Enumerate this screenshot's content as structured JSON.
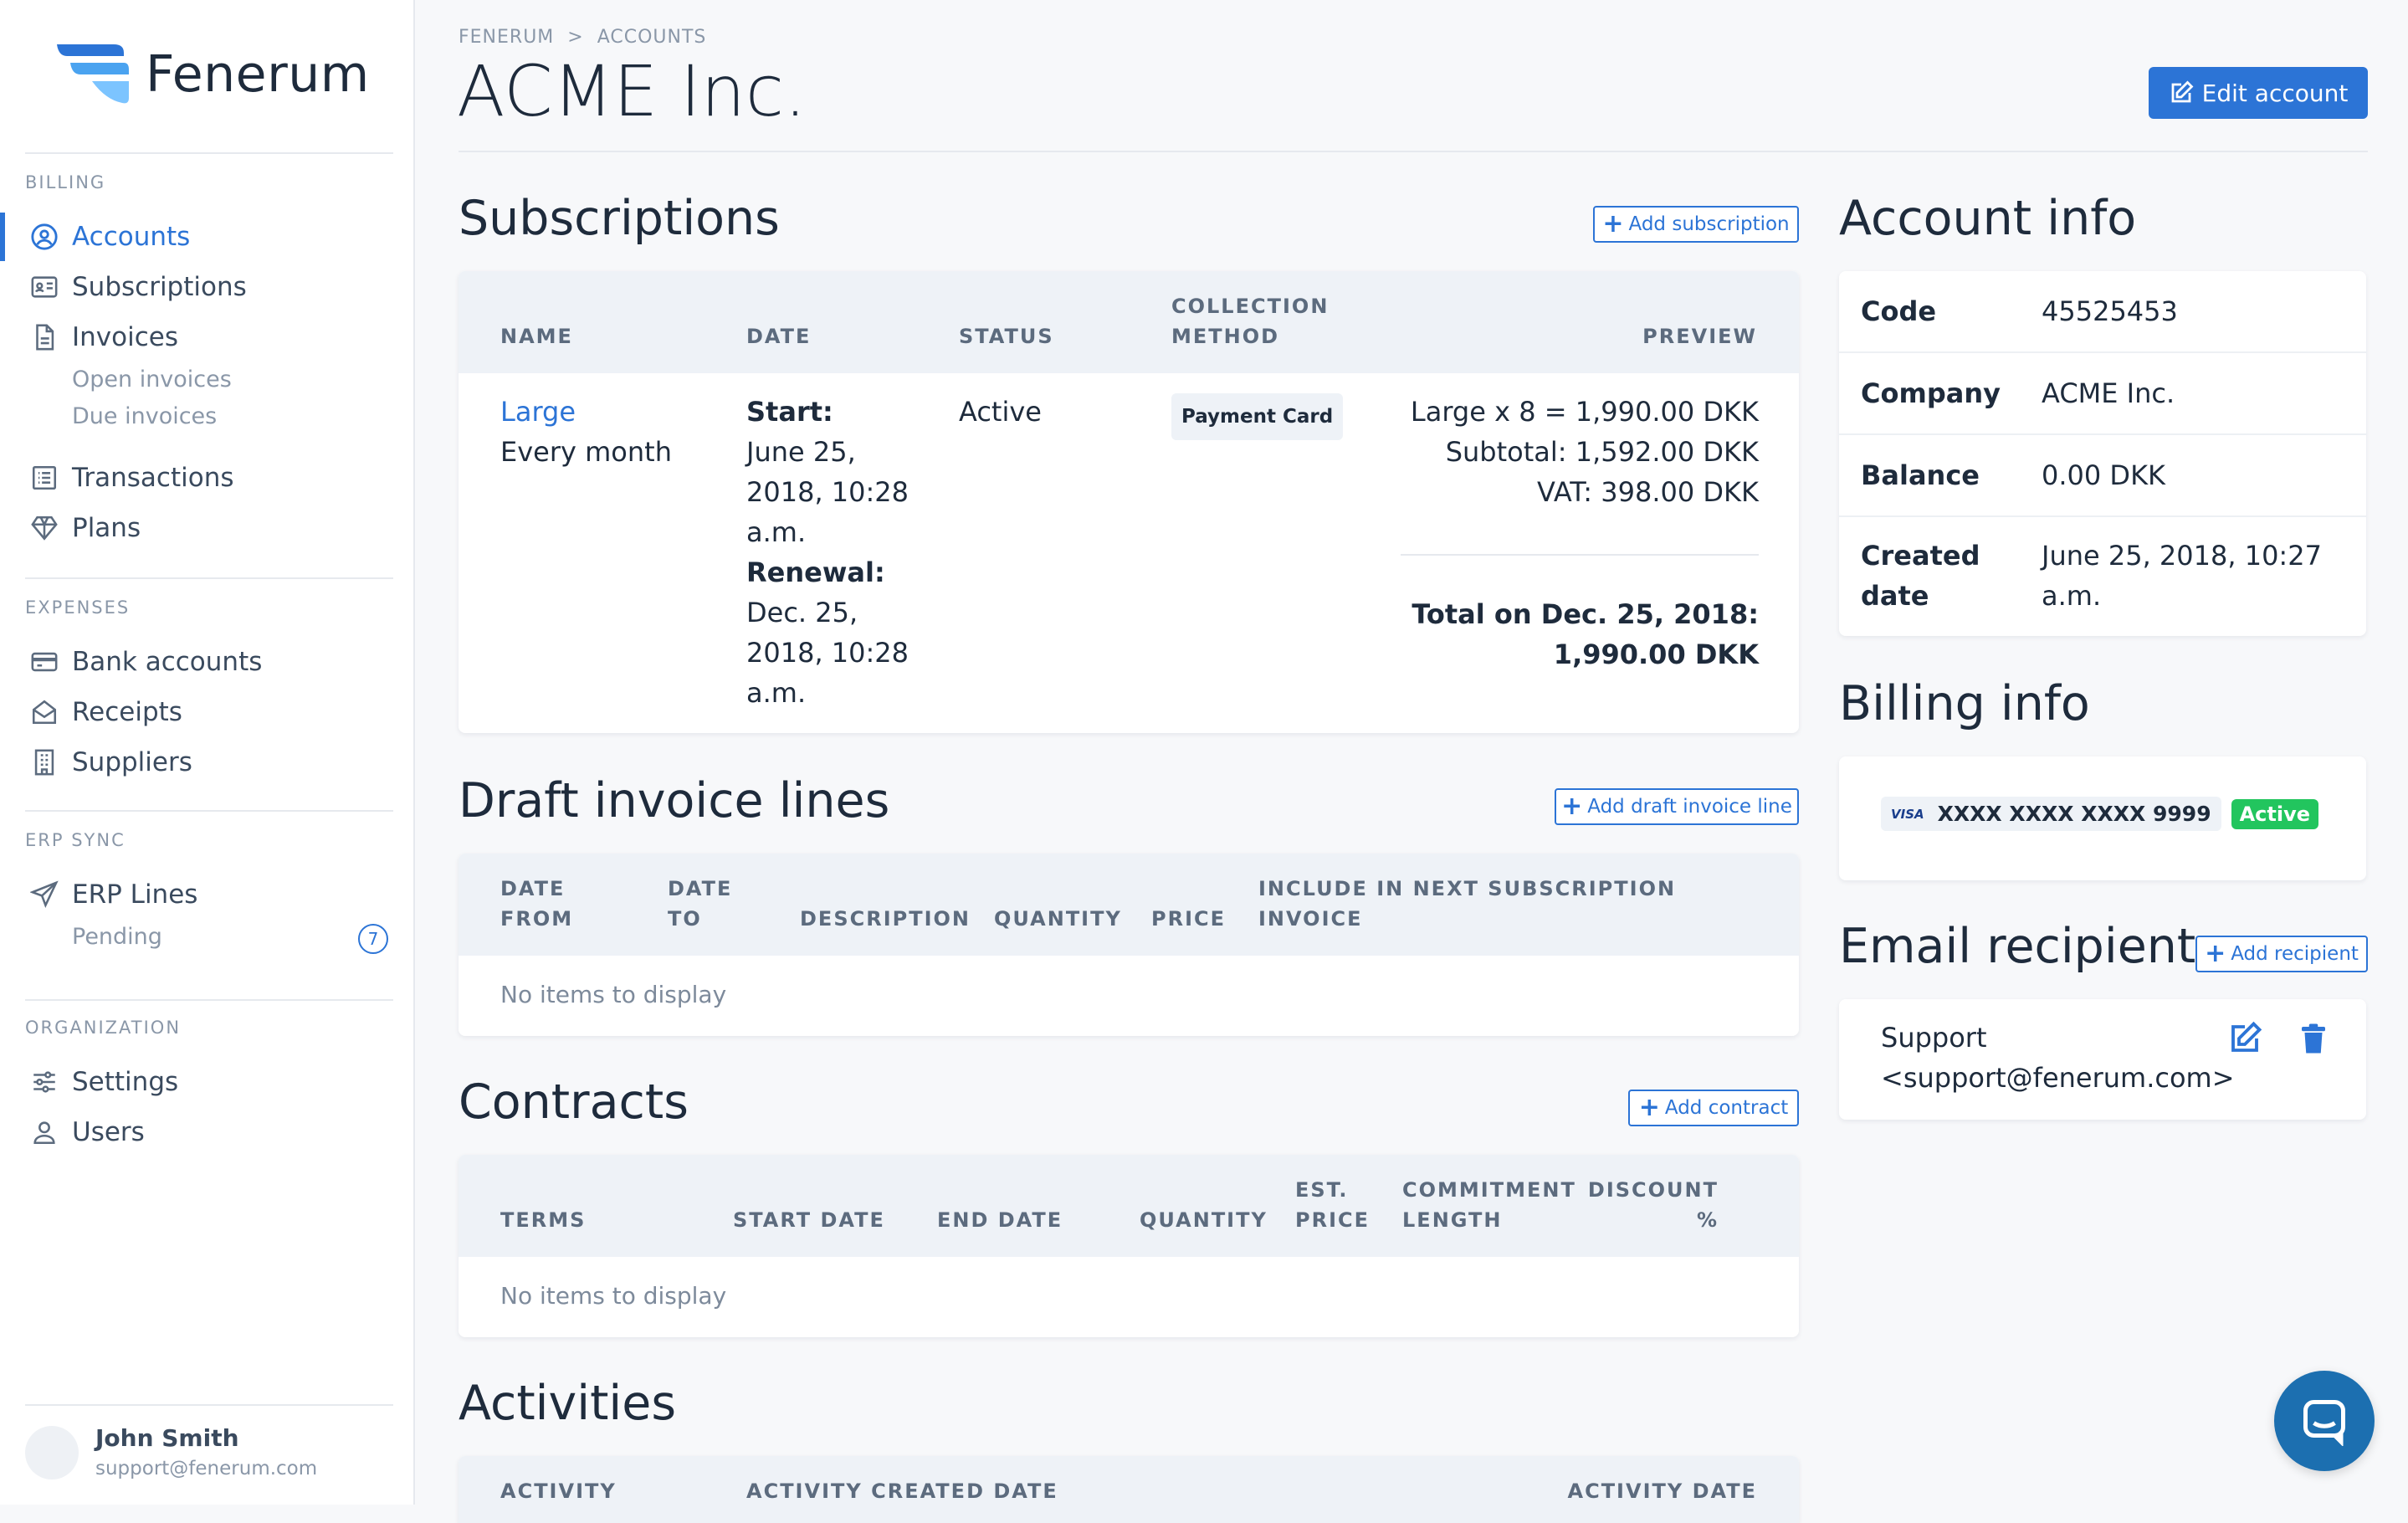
{
  "brand": {
    "name": "Fenerum",
    "accent": "#2c74d6"
  },
  "sidebar": {
    "sections": {
      "billing": "BILLING",
      "expenses": "EXPENSES",
      "erp": "ERP SYNC",
      "org": "ORGANIZATION"
    },
    "items": {
      "accounts": {
        "label": "Accounts",
        "icon": "user-circle-icon"
      },
      "subscriptions": {
        "label": "Subscriptions",
        "icon": "id-card-icon"
      },
      "invoices": {
        "label": "Invoices",
        "icon": "file-icon"
      },
      "open_invoices": "Open invoices",
      "due_invoices": "Due invoices",
      "transactions": {
        "label": "Transactions",
        "icon": "list-icon"
      },
      "plans": {
        "label": "Plans",
        "icon": "gem-icon"
      },
      "bank_accounts": {
        "label": "Bank accounts",
        "icon": "credit-card-icon"
      },
      "receipts": {
        "label": "Receipts",
        "icon": "envelope-open-icon"
      },
      "suppliers": {
        "label": "Suppliers",
        "icon": "building-icon"
      },
      "erp_lines": {
        "label": "ERP Lines",
        "icon": "paper-plane-icon"
      },
      "pending": {
        "label": "Pending",
        "count": "7"
      },
      "settings": {
        "label": "Settings",
        "icon": "sliders-icon"
      },
      "users": {
        "label": "Users",
        "icon": "user-icon"
      }
    },
    "user": {
      "name": "John Smith",
      "email": "support@fenerum.com"
    }
  },
  "header": {
    "breadcrumb": [
      "FENERUM",
      ">",
      "ACCOUNTS"
    ],
    "title": "ACME Inc.",
    "edit_button": "Edit account"
  },
  "subscriptions": {
    "title": "Subscriptions",
    "add_button": "Add subscription",
    "columns": {
      "name": "NAME",
      "date": "DATE",
      "status": "STATUS",
      "method_1": "COLLECTION",
      "method_2": "METHOD",
      "preview": "PREVIEW"
    },
    "rows": [
      {
        "name": "Large",
        "interval": "Every month",
        "start_label": "Start:",
        "start_1": "June 25,",
        "start_2": "2018, 10:28",
        "start_3": "a.m.",
        "renewal_label": "Renewal:",
        "renewal_1": "Dec. 25,",
        "renewal_2": "2018, 10:28",
        "renewal_3": "a.m.",
        "status": "Active",
        "method": "Payment Card",
        "preview_line": "Large x 8 = 1,990.00 DKK",
        "subtotal": "Subtotal: 1,592.00 DKK",
        "vat": "VAT: 398.00 DKK",
        "total_label": "Total on Dec. 25, 2018:",
        "total_value": "1,990.00 DKK"
      }
    ]
  },
  "draft_lines": {
    "title": "Draft invoice lines",
    "add_button": "Add draft invoice line",
    "columns": {
      "date_from_1": "DATE",
      "date_from_2": "FROM",
      "date_to_1": "DATE",
      "date_to_2": "TO",
      "description": "DESCRIPTION",
      "quantity": "QUANTITY",
      "price": "PRICE",
      "include_1": "INCLUDE IN NEXT SUBSCRIPTION",
      "include_2": "INVOICE"
    },
    "empty": "No items to display"
  },
  "contracts": {
    "title": "Contracts",
    "add_button": "Add contract",
    "columns": {
      "terms": "TERMS",
      "start": "START DATE",
      "end": "END DATE",
      "quantity": "QUANTITY",
      "est_1": "EST.",
      "est_2": "PRICE",
      "commit_1": "COMMITMENT",
      "commit_2": "LENGTH",
      "discount_1": "DISCOUNT",
      "discount_2": "%"
    },
    "empty": "No items to display"
  },
  "activities": {
    "title": "Activities",
    "columns": {
      "activity": "ACTIVITY",
      "created": "ACTIVITY CREATED DATE",
      "date": "ACTIVITY DATE"
    }
  },
  "account_info": {
    "title": "Account info",
    "rows": [
      {
        "key": "Code",
        "value": "45525453"
      },
      {
        "key": "Company",
        "value": "ACME Inc."
      },
      {
        "key": "Balance",
        "value": "0.00 DKK"
      },
      {
        "key_1": "Created",
        "key_2": "date",
        "value_1": "June 25, 2018, 10:27",
        "value_2": "a.m."
      }
    ]
  },
  "billing_info": {
    "title": "Billing info",
    "card_brand": "VISA",
    "card_number": "XXXX XXXX XXXX 9999",
    "status": "Active",
    "status_color": "#22c55e"
  },
  "email_recipients": {
    "title": "Email recipients",
    "add_button": "Add recipient",
    "items": [
      {
        "name": "Support",
        "email": "<support@fenerum.com>"
      }
    ]
  }
}
